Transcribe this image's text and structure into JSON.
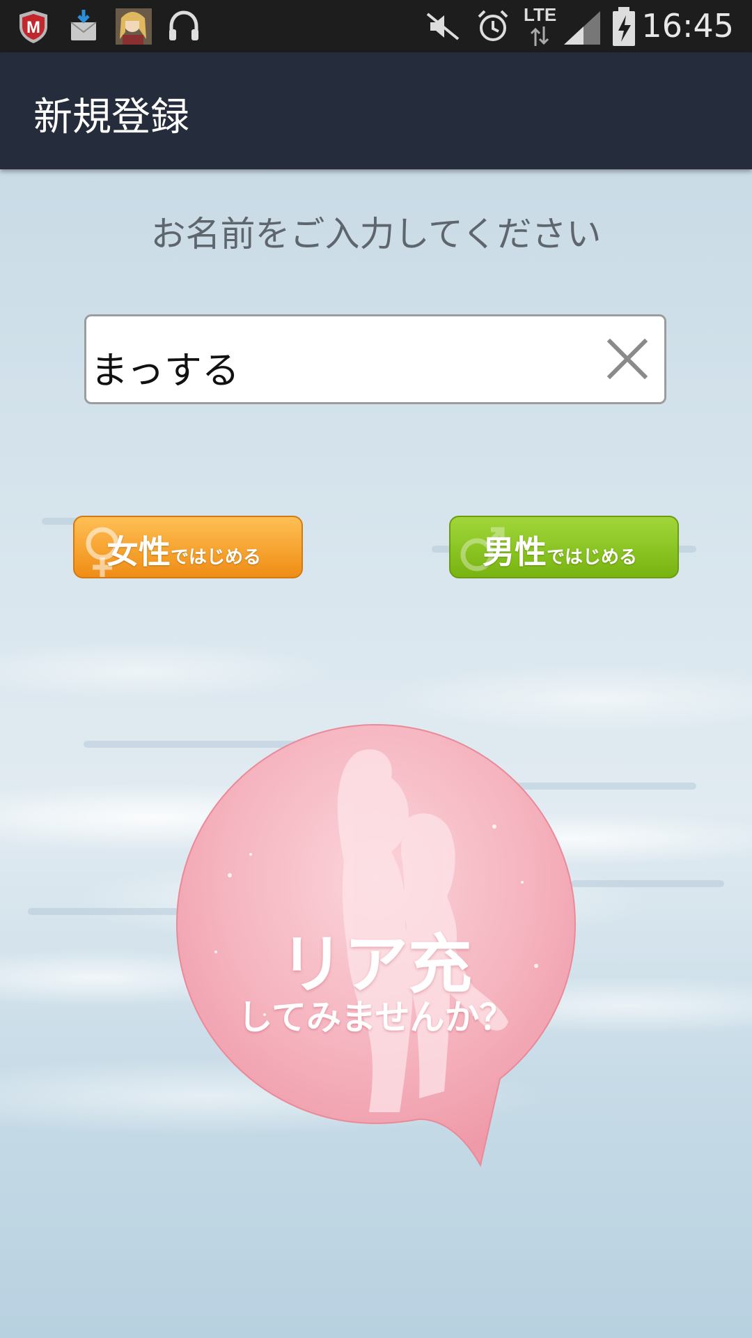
{
  "status_bar": {
    "time": "16:45",
    "network": "LTE",
    "icons": [
      "mcafee-shield-icon",
      "mail-download-icon",
      "avatar-thumbnail",
      "headphones-icon",
      "mute-icon",
      "alarm-icon",
      "signal-icon",
      "battery-charging-icon"
    ]
  },
  "app_bar": {
    "title": "新規登録"
  },
  "form": {
    "prompt": "お名前をご入力してください",
    "name_value": "まっする",
    "clear_icon": "close-icon"
  },
  "gender_buttons": {
    "female": {
      "main": "女性",
      "suffix": "ではじめる",
      "icon": "female-symbol-icon",
      "color": "#f7a634"
    },
    "male": {
      "main": "男性",
      "suffix": "ではじめる",
      "icon": "male-symbol-icon",
      "color": "#8cc625"
    }
  },
  "promo": {
    "title": "リア充",
    "subtitle": "してみませんか？",
    "color": "#f2a7b2"
  }
}
